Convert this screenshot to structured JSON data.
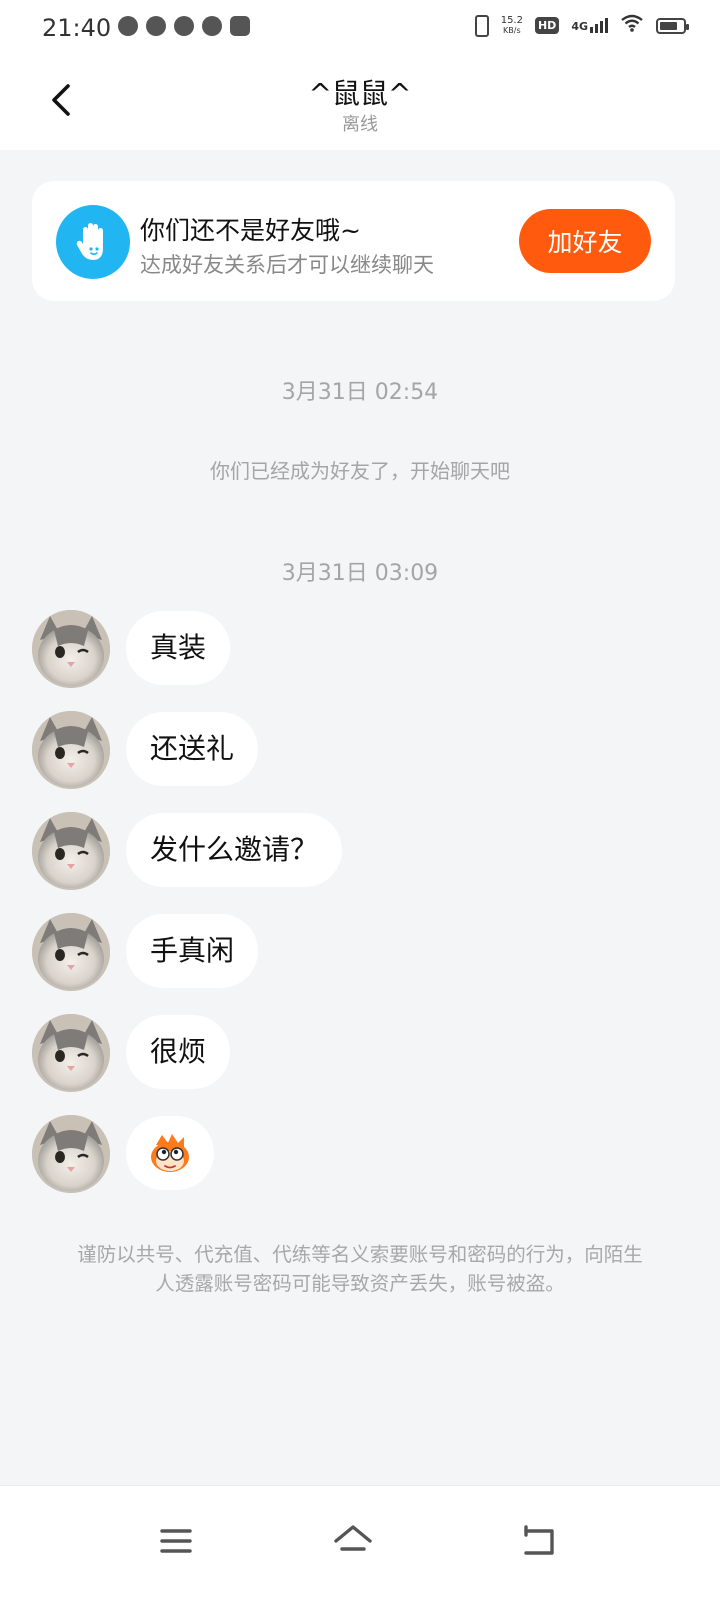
{
  "status_bar": {
    "time": "21:40",
    "speed_value": "15.2",
    "speed_unit": "KB/s",
    "hd": "HD",
    "network": "4G",
    "left_icons": [
      "wechat-icon",
      "taobao-icon",
      "chat-bubble-icon",
      "cloud-icon",
      "bag-icon"
    ]
  },
  "header": {
    "title": "^鼠鼠^",
    "subtitle": "离线"
  },
  "friend_card": {
    "title": "你们还不是好友哦~",
    "subtitle": "达成好友关系后才可以继续聊天",
    "add_button": "加好友",
    "accent_color": "#ff5a0d",
    "icon_color": "#21b6f2"
  },
  "timeline": {
    "timestamp_1": "3月31日 02:54",
    "system_message": "你们已经成为好友了，开始聊天吧",
    "timestamp_2": "3月31日 03:09"
  },
  "messages": [
    {
      "text": "真装"
    },
    {
      "text": "还送礼"
    },
    {
      "text": "发什么邀请？"
    },
    {
      "text": "手真闲"
    },
    {
      "text": "很烦"
    },
    {
      "text": "",
      "sticker": "cartoon-face-sticker"
    }
  ],
  "warning": "谨防以共号、代充值、代练等名义索要账号和密码的行为，向陌生人透露账号密码可能导致资产丢失，账号被盗。",
  "nav_bar": {
    "icons": [
      "menu-icon",
      "home-icon",
      "back-icon"
    ]
  }
}
